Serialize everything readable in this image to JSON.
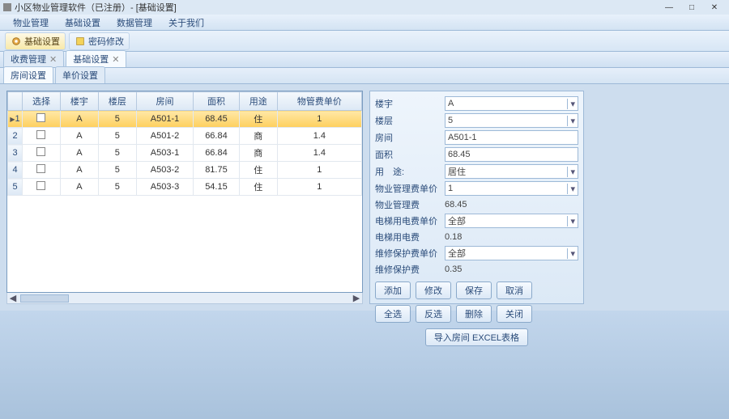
{
  "window": {
    "title": "小区物业管理软件（已注册）- [基础设置]"
  },
  "menu": {
    "items": [
      "物业管理",
      "基础设置",
      "数据管理",
      "关于我们"
    ]
  },
  "toolbar": {
    "btn1": {
      "label": "基础设置"
    },
    "btn2": {
      "label": "密码修改"
    }
  },
  "tabs1": [
    {
      "label": "收费管理",
      "close": "✕"
    },
    {
      "label": "基础设置",
      "close": "✕"
    }
  ],
  "tabs2": [
    {
      "label": "房间设置"
    },
    {
      "label": "单价设置"
    }
  ],
  "grid": {
    "headers": [
      "选择",
      "楼宇",
      "楼层",
      "房间",
      "面积",
      "用途",
      "物管费单价"
    ],
    "rows": [
      {
        "n": "1",
        "b": "A",
        "f": "5",
        "r": "A501-1",
        "a": "68.45",
        "u": "住",
        "p": "1"
      },
      {
        "n": "2",
        "b": "A",
        "f": "5",
        "r": "A501-2",
        "a": "66.84",
        "u": "商",
        "p": "1.4"
      },
      {
        "n": "3",
        "b": "A",
        "f": "5",
        "r": "A503-1",
        "a": "66.84",
        "u": "商",
        "p": "1.4"
      },
      {
        "n": "4",
        "b": "A",
        "f": "5",
        "r": "A503-2",
        "a": "81.75",
        "u": "住",
        "p": "1"
      },
      {
        "n": "5",
        "b": "A",
        "f": "5",
        "r": "A503-3",
        "a": "54.15",
        "u": "住",
        "p": "1"
      }
    ]
  },
  "form": {
    "building_label": "楼宇",
    "building": "A",
    "floor_label": "楼层",
    "floor": "5",
    "room_label": "房间",
    "room": "A501-1",
    "area_label": "面积",
    "area": "68.45",
    "usage_label": "用　途:",
    "usage": "居住",
    "mgmt_price_label": "物业管理费单价",
    "mgmt_price": "1",
    "mgmt_fee_label": "物业管理费",
    "mgmt_fee": "68.45",
    "elev_price_label": "电梯用电费单价",
    "elev_price": "全部",
    "elev_fee_label": "电梯用电费",
    "elev_fee": "0.18",
    "maint_price_label": "维修保护费单价",
    "maint_price": "全部",
    "maint_fee_label": "维修保护费",
    "maint_fee": "0.35"
  },
  "buttons": {
    "add": "添加",
    "edit": "修改",
    "save": "保存",
    "cancel": "取消",
    "all": "全选",
    "invert": "反选",
    "delete": "删除",
    "close": "关闭",
    "export": "导入房间 EXCEL表格"
  },
  "winbtns": {
    "min": "—",
    "max": "□",
    "close": "✕"
  }
}
